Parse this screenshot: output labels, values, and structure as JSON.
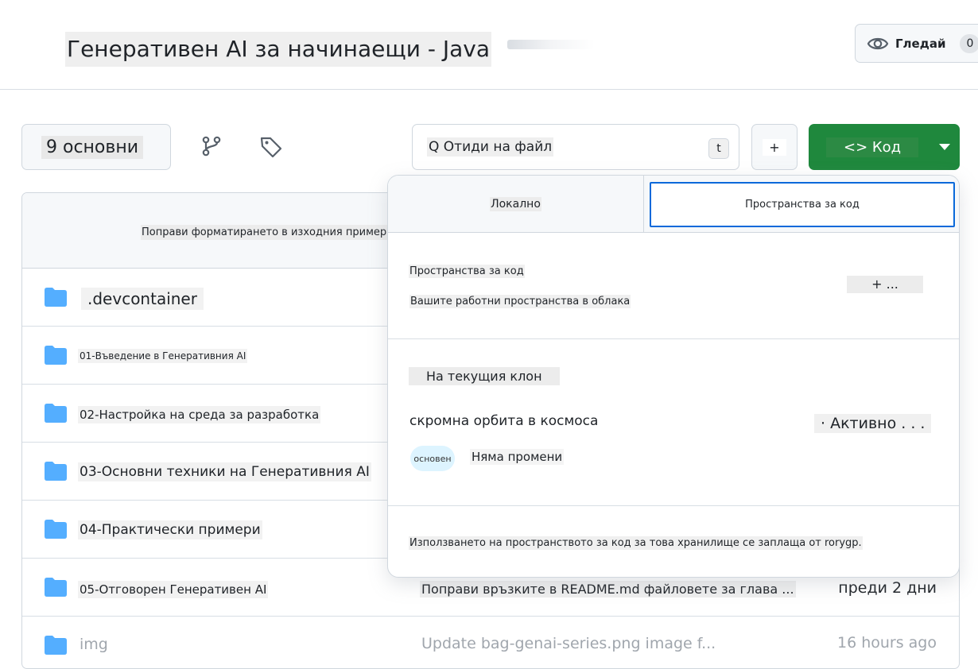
{
  "header": {
    "repo_title": "Генеративен AI за начинаещи - Java",
    "watch_label": "Гледай",
    "watch_count": "0"
  },
  "toolbar": {
    "branch_label": "9 основни",
    "goto_file": "Q Отиди на файл",
    "goto_kbd": "t",
    "add_label": "+",
    "code_label": "<> Код"
  },
  "files": {
    "latest_commit_message": "Поправи форматирането в изходния пример",
    "rows": [
      {
        "name": ".devcontainer",
        "commit": "",
        "time": ""
      },
      {
        "name": "01-Въведение в Генеративния AI",
        "commit": "",
        "time": ""
      },
      {
        "name": "02-Настройка на среда за разработка",
        "commit": "",
        "time": ""
      },
      {
        "name": "03-Основни техники на Генеративния AI",
        "commit": "",
        "time": ""
      },
      {
        "name": "04-Практически примери",
        "commit": "",
        "time": ""
      },
      {
        "name": "05-Отговорен Генеративен AI",
        "commit": "Поправи връзките в README.md файловете за глава ...",
        "time": "преди 2 дни"
      },
      {
        "name": "img",
        "commit": "Update bag-genai-series.png image f...",
        "time": "16 hours ago"
      }
    ]
  },
  "dropdown": {
    "tabs": {
      "local": "Локално",
      "codespaces": "Пространства за код"
    },
    "codespaces_heading": "Пространства за код",
    "codespaces_sub": "Вашите работни пространства в облака",
    "new_codespace": "+ ...",
    "current_branch_heading": "На текущия клон",
    "codespace_name": "скромна орбита в космоса",
    "codespace_status": "· Активно . . .",
    "codespace_branch": "основен",
    "codespace_changes": "Няма промени",
    "billing_note": "Използването на пространството за код за това хранилище се заплаща от rorygp."
  },
  "colors": {
    "code_button": "#1f883d",
    "folder": "#54aeff",
    "active_tab_border": "#0969da"
  },
  "icons": [
    "eye-icon",
    "branch-icon",
    "tag-icon",
    "folder-icon",
    "caret-down-icon"
  ]
}
